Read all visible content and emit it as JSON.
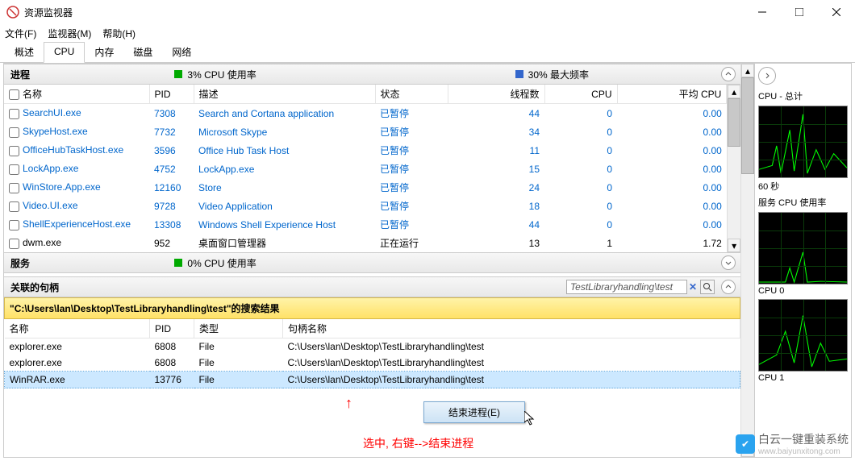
{
  "window": {
    "title": "资源监视器"
  },
  "menu": {
    "file": "文件(F)",
    "monitor": "监视器(M)",
    "help": "帮助(H)"
  },
  "tabs": {
    "overview": "概述",
    "cpu": "CPU",
    "memory": "内存",
    "disk": "磁盘",
    "network": "网络"
  },
  "proc": {
    "title": "进程",
    "cpu_usage": "3% CPU 使用率",
    "max_freq": "30% 最大频率",
    "cols": {
      "name": "名称",
      "pid": "PID",
      "desc": "描述",
      "status": "状态",
      "threads": "线程数",
      "cpu": "CPU",
      "avg": "平均 CPU"
    },
    "rows": [
      {
        "name": "SearchUI.exe",
        "pid": "7308",
        "desc": "Search and Cortana application",
        "status": "已暂停",
        "threads": "44",
        "cpu": "0",
        "avg": "0.00"
      },
      {
        "name": "SkypeHost.exe",
        "pid": "7732",
        "desc": "Microsoft Skype",
        "status": "已暂停",
        "threads": "34",
        "cpu": "0",
        "avg": "0.00"
      },
      {
        "name": "OfficeHubTaskHost.exe",
        "pid": "3596",
        "desc": "Office Hub Task Host",
        "status": "已暂停",
        "threads": "11",
        "cpu": "0",
        "avg": "0.00"
      },
      {
        "name": "LockApp.exe",
        "pid": "4752",
        "desc": "LockApp.exe",
        "status": "已暂停",
        "threads": "15",
        "cpu": "0",
        "avg": "0.00"
      },
      {
        "name": "WinStore.App.exe",
        "pid": "12160",
        "desc": "Store",
        "status": "已暂停",
        "threads": "24",
        "cpu": "0",
        "avg": "0.00"
      },
      {
        "name": "Video.UI.exe",
        "pid": "9728",
        "desc": "Video Application",
        "status": "已暂停",
        "threads": "18",
        "cpu": "0",
        "avg": "0.00"
      },
      {
        "name": "ShellExperienceHost.exe",
        "pid": "13308",
        "desc": "Windows Shell Experience Host",
        "status": "已暂停",
        "threads": "44",
        "cpu": "0",
        "avg": "0.00"
      },
      {
        "name": "dwm.exe",
        "pid": "952",
        "desc": "桌面窗口管理器",
        "status": "正在运行",
        "threads": "13",
        "cpu": "1",
        "avg": "1.72"
      }
    ]
  },
  "svc": {
    "title": "服务",
    "cpu_usage": "0% CPU 使用率"
  },
  "handles": {
    "title": "关联的句柄",
    "search_value": "TestLibraryhandling\\test",
    "search_result_label": "\"C:\\Users\\lan\\Desktop\\TestLibraryhandling\\test\"的搜索结果",
    "cols": {
      "name": "名称",
      "pid": "PID",
      "type": "类型",
      "handle": "句柄名称"
    },
    "rows": [
      {
        "name": "explorer.exe",
        "pid": "6808",
        "type": "File",
        "handle": "C:\\Users\\lan\\Desktop\\TestLibraryhandling\\test"
      },
      {
        "name": "explorer.exe",
        "pid": "6808",
        "type": "File",
        "handle": "C:\\Users\\lan\\Desktop\\TestLibraryhandling\\test"
      },
      {
        "name": "WinRAR.exe",
        "pid": "13776",
        "type": "File",
        "handle": "C:\\Users\\lan\\Desktop\\TestLibraryhandling\\test"
      }
    ]
  },
  "ctx": {
    "end_process": "结束进程(E)"
  },
  "annot": {
    "red": "选中, 右键-->结束进程"
  },
  "side": {
    "cpu_total": "CPU - 总计",
    "sixty_sec": "60 秒",
    "svc_cpu": "服务 CPU 使用率",
    "cpu0": "CPU 0",
    "cpu1": "CPU 1"
  },
  "brand": {
    "name": "白云一键重装系统",
    "url": "www.baiyunxitong.com"
  }
}
